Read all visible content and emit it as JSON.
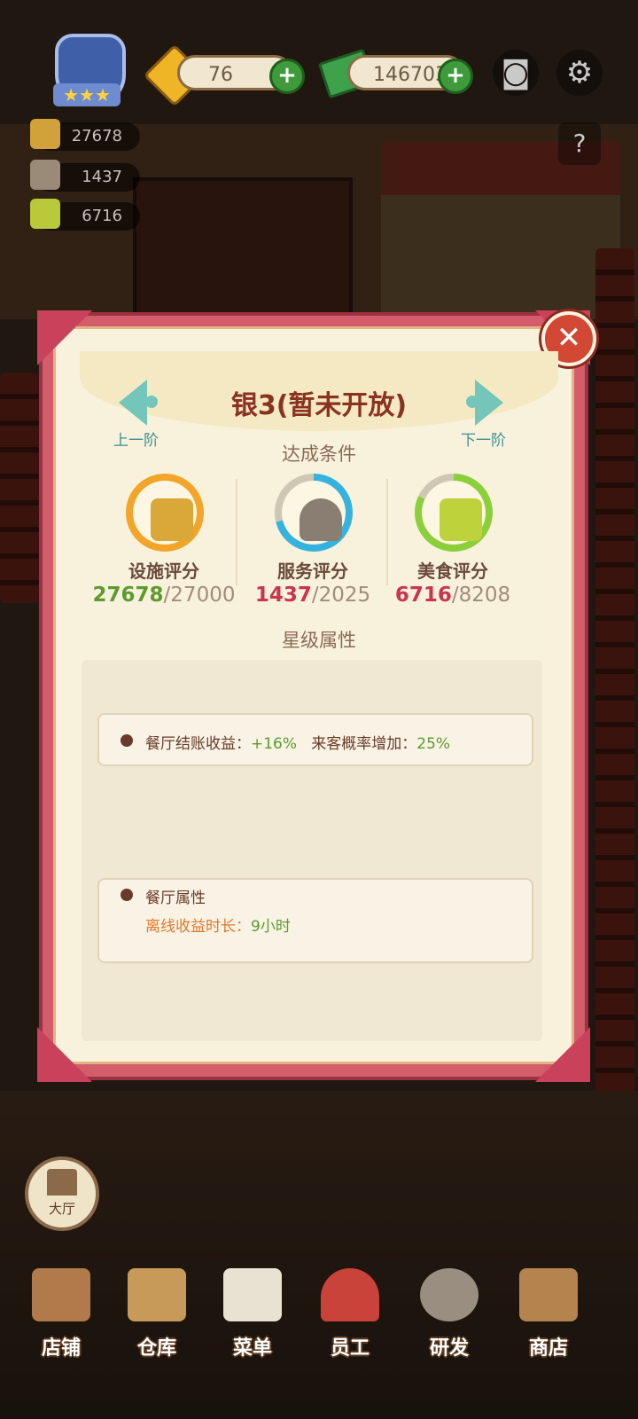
{
  "hud": {
    "diamonds": "76",
    "cash": "146703",
    "stats": {
      "facility": "27678",
      "service": "1437",
      "food": "6716"
    }
  },
  "dialog": {
    "title": "银3(暂未开放)",
    "prev_label": "上一阶",
    "next_label": "下一阶",
    "conditions_label": "达成条件",
    "scores": [
      {
        "name": "设施评分",
        "current": "27678",
        "required": "/27000",
        "ring_color": "#f2a529",
        "progress": 1.0
      },
      {
        "name": "服务评分",
        "current": "1437",
        "required": "/2025",
        "ring_color": "#35b3dd",
        "progress": 0.71
      },
      {
        "name": "美食评分",
        "current": "6716",
        "required": "/8208",
        "ring_color": "#8bcf3b",
        "progress": 0.82
      }
    ],
    "star_attr_label": "星级属性",
    "attr_line_1": {
      "key1": "餐厅结账收益：",
      "val1": "+16%",
      "key2": "来客概率增加：",
      "val2": "25%"
    },
    "restaurant_attr": {
      "heading": "餐厅属性",
      "key": "离线收益时长：",
      "value": "9小时"
    }
  },
  "hall_button": "大厅",
  "bottom_tabs": [
    "店铺",
    "仓库",
    "菜单",
    "员工",
    "研发",
    "商店"
  ],
  "colors": {
    "frame": "#d35d6b",
    "panel": "#f8f2dd",
    "title": "#8a3220",
    "nav": "#3d8f91",
    "green_value": "#5d9a2e",
    "red_value": "#c9354c",
    "orange_key": "#e2782e"
  },
  "icons": [
    "trophy-icon",
    "gem-icon",
    "cash-icon",
    "camera-icon",
    "gear-icon",
    "help-book-icon",
    "close-icon",
    "anvil-icon",
    "cloche-icon",
    "recipe-book-icon"
  ]
}
